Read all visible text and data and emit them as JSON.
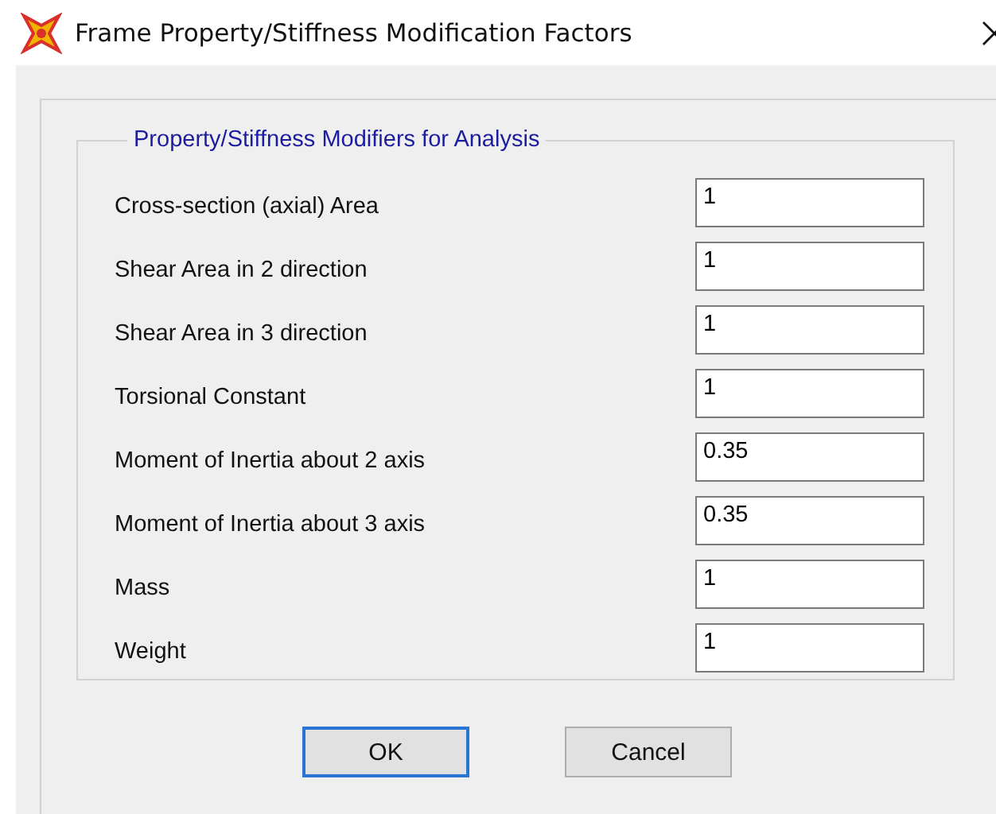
{
  "window": {
    "title": "Frame Property/Stiffness Modification Factors"
  },
  "group": {
    "title": "Property/Stiffness Modifiers for Analysis",
    "fields": [
      {
        "label": "Cross-section (axial) Area",
        "value": "1"
      },
      {
        "label": "Shear Area in 2 direction",
        "value": "1"
      },
      {
        "label": "Shear Area in 3 direction",
        "value": "1"
      },
      {
        "label": "Torsional Constant",
        "value": "1"
      },
      {
        "label": "Moment of Inertia about 2 axis",
        "value": "0.35"
      },
      {
        "label": "Moment of Inertia about 3 axis",
        "value": "0.35"
      },
      {
        "label": "Mass",
        "value": "1"
      },
      {
        "label": "Weight",
        "value": "1"
      }
    ]
  },
  "buttons": [
    {
      "label": "OK",
      "default": true
    },
    {
      "label": "Cancel",
      "default": false
    }
  ]
}
